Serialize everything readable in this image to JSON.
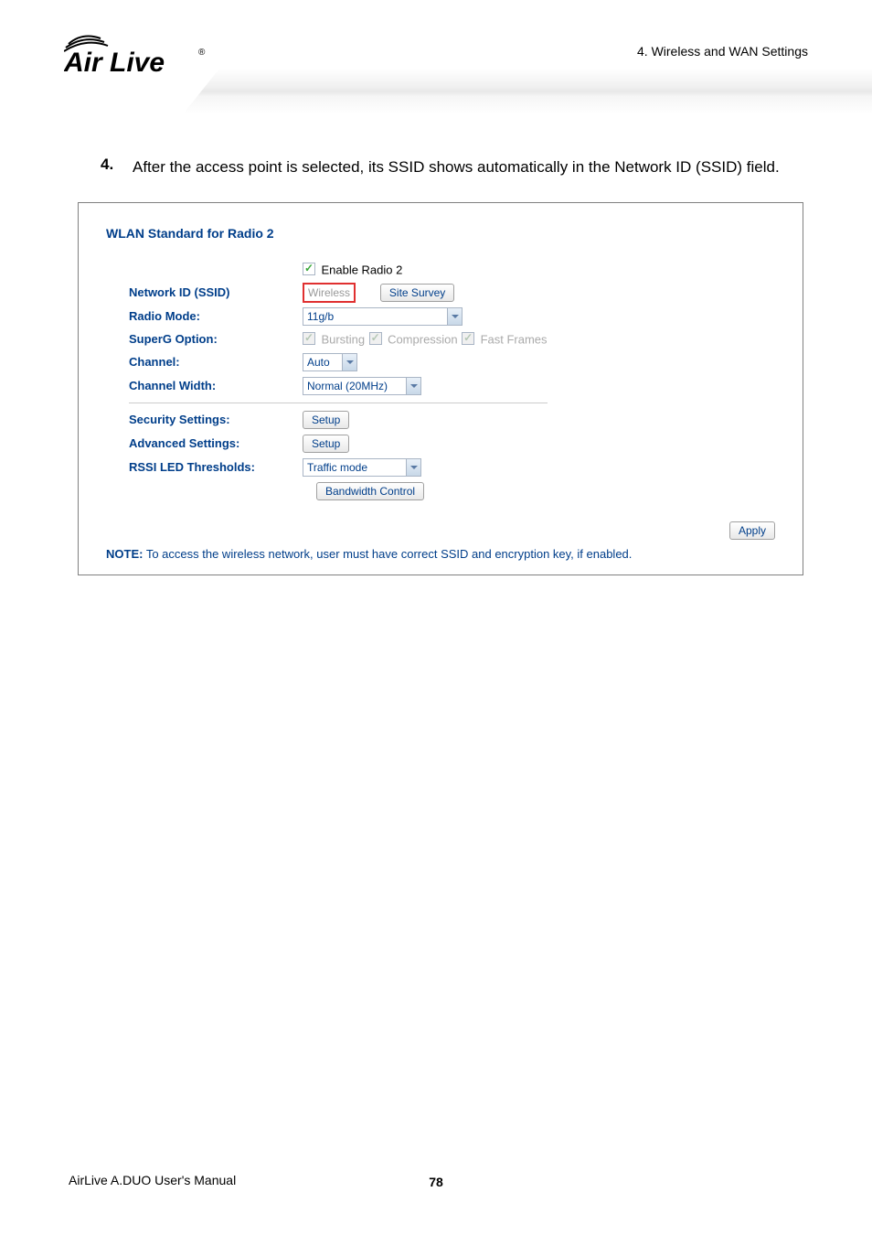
{
  "header": {
    "breadcrumb": "4. Wireless and WAN Settings",
    "logo_text": "Air Live"
  },
  "instruction": {
    "number": "4.",
    "text": "After the access point is selected, its SSID shows automatically in the Network ID (SSID) field."
  },
  "panel": {
    "title": "WLAN Standard for Radio 2",
    "enable_label": "Enable Radio 2",
    "rows": {
      "ssid": {
        "label": "Network ID (SSID)",
        "value": "Wireless",
        "button": "Site Survey"
      },
      "radio_mode": {
        "label": "Radio Mode:",
        "value": "11g/b"
      },
      "superg": {
        "label": "SuperG Option:",
        "opts": [
          "Bursting",
          "Compression",
          "Fast Frames"
        ]
      },
      "channel": {
        "label": "Channel:",
        "value": "Auto"
      },
      "channel_width": {
        "label": "Channel Width:",
        "value": "Normal (20MHz)"
      },
      "security": {
        "label": "Security Settings:",
        "button": "Setup"
      },
      "advanced": {
        "label": "Advanced Settings:",
        "button": "Setup"
      },
      "rssi": {
        "label": "RSSI LED Thresholds:",
        "value": "Traffic mode",
        "button": "Bandwidth Control"
      }
    },
    "apply": "Apply",
    "note_bold": "NOTE:",
    "note_text": " To access the wireless network, user must have correct SSID and encryption key, if enabled."
  },
  "footer": {
    "left": "AirLive A.DUO User's Manual",
    "page": "78"
  }
}
